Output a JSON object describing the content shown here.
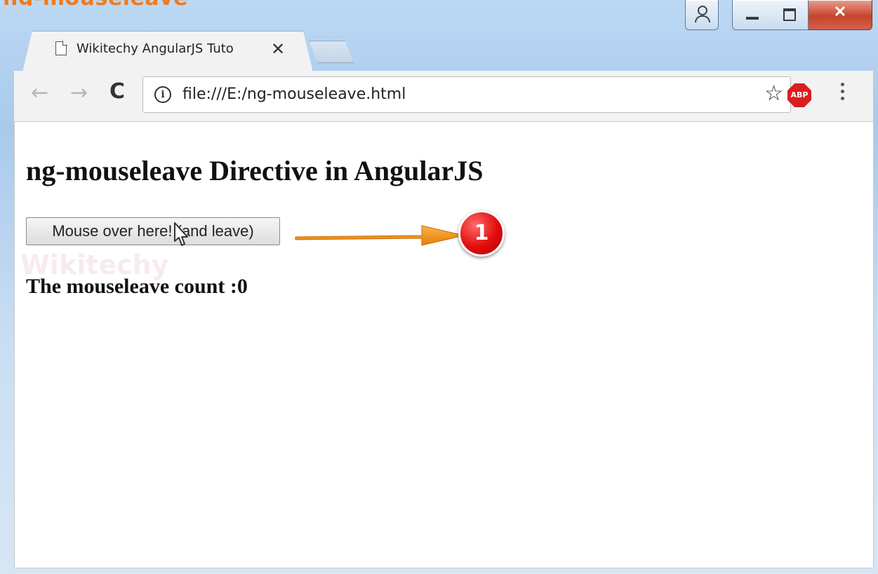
{
  "window": {
    "top_cut_text": "ng-mouseleave",
    "tab": {
      "title": "Wikitechy AngularJS Tuto",
      "close_glyph": "✕"
    },
    "address_bar": {
      "url": "file:///E:/ng-mouseleave.html"
    },
    "extension_badge": "ABP"
  },
  "page": {
    "heading": "ng-mouseleave Directive in AngularJS",
    "button_label": "Mouse over here! (and leave)",
    "count_label": "The mouseleave count :",
    "count_value": "0",
    "watermark": "Wikitechy",
    "callout_number": "1"
  },
  "colors": {
    "accent_orange": "#f39213",
    "badge_red": "#e10c0c",
    "close_red": "#c7442b"
  },
  "icons": {
    "tab": "document-icon",
    "back": "arrow-left-icon",
    "forward": "arrow-right-icon",
    "reload": "reload-icon",
    "info": "info-icon",
    "bookmark": "star-icon",
    "menu": "kebab-menu-icon"
  }
}
